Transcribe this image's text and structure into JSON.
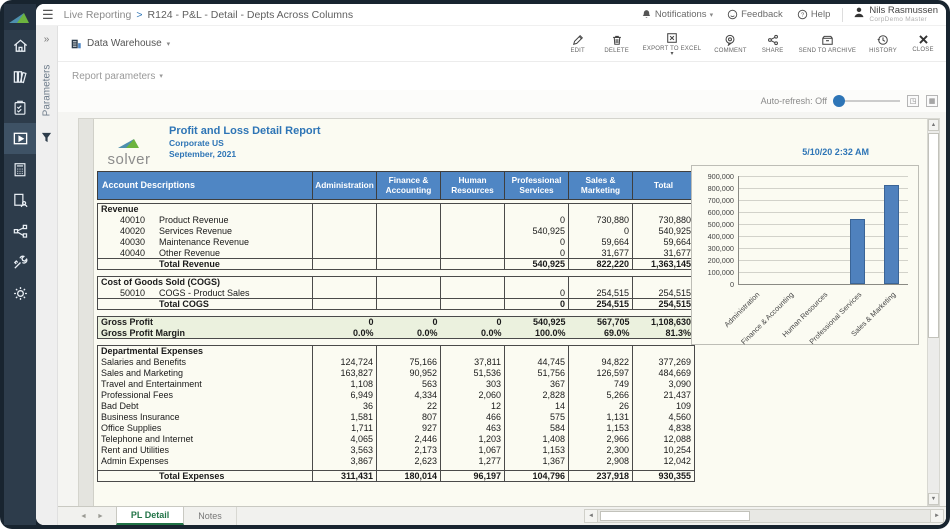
{
  "colors": {
    "accent_blue": "#2e75b6",
    "table_header_bg": "#4f86c4",
    "bar_fill": "#4f81bd",
    "gross_profit_bg": "#ebf1de",
    "active_tab_green": "#217346",
    "sidebar_bg": "#2d3c4b",
    "sidebar_selected_bg": "#3e5265",
    "frame": "#18242f",
    "page_bg": "#fbfbf2"
  },
  "topbar": {
    "breadcrumb": {
      "section": "Live Reporting",
      "separator": ">",
      "title": "R124 - P&L - Detail - Depts Across Columns"
    },
    "notifications_label": "Notifications",
    "feedback_label": "Feedback",
    "help_label": "Help",
    "user_name": "Nils Rasmussen",
    "user_role": "CorpDemo Master"
  },
  "toolbar": {
    "source_label": "Data Warehouse",
    "actions": [
      {
        "label": "EDIT"
      },
      {
        "label": "DELETE"
      },
      {
        "label": "EXPORT TO EXCEL",
        "has_caret": true
      },
      {
        "label": "COMMENT"
      },
      {
        "label": "SHARE"
      },
      {
        "label": "SEND TO ARCHIVE"
      },
      {
        "label": "HISTORY"
      },
      {
        "label": "CLOSE"
      }
    ]
  },
  "parameters_panel": {
    "label": "Parameters"
  },
  "report_parameters": {
    "label": "Report parameters"
  },
  "auto_refresh": {
    "label": "Auto-refresh: Off"
  },
  "report": {
    "logo_text": "solver",
    "title": "Profit and Loss Detail Report",
    "entity": "Corporate US",
    "period": "September,  2021",
    "timestamp": "5/10/20 2:32 AM",
    "table": {
      "columns": [
        "Account Descriptions",
        "Administration",
        "Finance & Accounting",
        "Human Resources",
        "Professional Services",
        "Sales & Marketing",
        "Total"
      ],
      "sections": [
        {
          "name": "revenue",
          "rows": [
            {
              "type": "section",
              "label": "Revenue",
              "values": [
                "",
                "",
                "",
                "",
                "",
                ""
              ]
            },
            {
              "type": "account",
              "code": "40010",
              "label": "Product Revenue",
              "values": [
                "",
                "",
                "",
                "0",
                "730,880",
                "730,880"
              ]
            },
            {
              "type": "account",
              "code": "40020",
              "label": "Services Revenue",
              "values": [
                "",
                "",
                "",
                "540,925",
                "0",
                "540,925"
              ]
            },
            {
              "type": "account",
              "code": "40030",
              "label": "Maintenance Revenue",
              "values": [
                "",
                "",
                "",
                "0",
                "59,664",
                "59,664"
              ]
            },
            {
              "type": "account",
              "code": "40040",
              "label": "Other Revenue",
              "values": [
                "",
                "",
                "",
                "0",
                "31,677",
                "31,677"
              ]
            },
            {
              "type": "total",
              "label": "Total Revenue",
              "values": [
                "",
                "",
                "",
                "540,925",
                "822,220",
                "1,363,145"
              ]
            }
          ]
        },
        {
          "name": "cogs",
          "rows": [
            {
              "type": "section",
              "label": "Cost of Goods Sold (COGS)",
              "values": [
                "",
                "",
                "",
                "",
                "",
                ""
              ]
            },
            {
              "type": "account",
              "code": "50010",
              "label": "COGS - Product Sales",
              "values": [
                "",
                "",
                "",
                "0",
                "254,515",
                "254,515"
              ]
            },
            {
              "type": "total",
              "label": "Total COGS",
              "values": [
                "",
                "",
                "",
                "0",
                "254,515",
                "254,515"
              ]
            }
          ]
        },
        {
          "name": "gross-profit",
          "style": "green",
          "no_sep": true,
          "rows": [
            {
              "type": "gp",
              "label": "Gross Profit",
              "values": [
                "0",
                "0",
                "0",
                "540,925",
                "567,705",
                "1,108,630"
              ]
            },
            {
              "type": "gp",
              "label": "Gross Profit Margin",
              "values": [
                "0.0%",
                "0.0%",
                "0.0%",
                "100.0%",
                "69.0%",
                "81.3%"
              ]
            }
          ]
        },
        {
          "name": "expenses",
          "rows": [
            {
              "type": "section",
              "label": "Departmental Expenses",
              "values": [
                "",
                "",
                "",
                "",
                "",
                ""
              ]
            },
            {
              "type": "expense",
              "label": "Salaries and Benefits",
              "values": [
                "124,724",
                "75,166",
                "37,811",
                "44,745",
                "94,822",
                "377,269"
              ]
            },
            {
              "type": "expense",
              "label": "Sales and Marketing",
              "values": [
                "163,827",
                "90,952",
                "51,536",
                "51,756",
                "126,597",
                "484,669"
              ]
            },
            {
              "type": "expense",
              "label": "Travel and Entertainment",
              "values": [
                "1,108",
                "563",
                "303",
                "367",
                "749",
                "3,090"
              ]
            },
            {
              "type": "expense",
              "label": "Professional Fees",
              "values": [
                "6,949",
                "4,334",
                "2,060",
                "2,828",
                "5,266",
                "21,437"
              ]
            },
            {
              "type": "expense",
              "label": "Bad Debt",
              "values": [
                "36",
                "22",
                "12",
                "14",
                "26",
                "109"
              ]
            },
            {
              "type": "expense",
              "label": "Business Insurance",
              "values": [
                "1,581",
                "807",
                "466",
                "575",
                "1,131",
                "4,560"
              ]
            },
            {
              "type": "expense",
              "label": "Office Supplies",
              "values": [
                "1,711",
                "927",
                "463",
                "584",
                "1,153",
                "4,838"
              ]
            },
            {
              "type": "expense",
              "label": "Telephone and Internet",
              "values": [
                "4,065",
                "2,446",
                "1,203",
                "1,408",
                "2,966",
                "12,088"
              ]
            },
            {
              "type": "expense",
              "label": "Rent and Utilities",
              "values": [
                "3,563",
                "2,173",
                "1,067",
                "1,153",
                "2,300",
                "10,254"
              ]
            },
            {
              "type": "expense",
              "label": "Admin Expenses",
              "values": [
                "3,867",
                "2,623",
                "1,277",
                "1,367",
                "2,908",
                "12,042"
              ]
            },
            {
              "type": "total",
              "label": "Total Expenses",
              "gap_before": true,
              "values": [
                "311,431",
                "180,014",
                "96,197",
                "104,796",
                "237,918",
                "930,355"
              ]
            }
          ]
        }
      ]
    }
  },
  "chart_data": {
    "type": "bar",
    "categories": [
      "Administration",
      "Finance & Accounting",
      "Human Resources",
      "Professional Services",
      "Sales & Marketing"
    ],
    "values": [
      0,
      0,
      0,
      540925,
      822220
    ],
    "title": "",
    "xlabel": "",
    "ylabel": "",
    "ylim": [
      0,
      900000
    ],
    "ytick_labels": [
      "900,000",
      "800,000",
      "700,000",
      "600,000",
      "500,000",
      "400,000",
      "300,000",
      "200,000",
      "100,000",
      "0"
    ],
    "grid": true,
    "legend": false,
    "bar_color": "#4f81bd"
  },
  "sheet_tabs": {
    "tabs": [
      {
        "label": "PL Detail",
        "active": true
      },
      {
        "label": "Notes",
        "active": false
      }
    ]
  }
}
